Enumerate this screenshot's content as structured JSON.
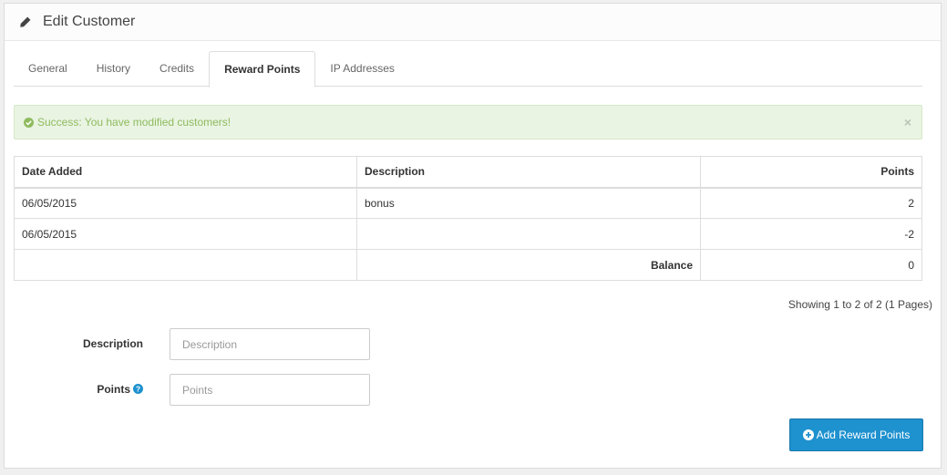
{
  "header": {
    "title": "Edit Customer",
    "icon": "pencil-icon"
  },
  "tabs": [
    {
      "label": "General",
      "active": false
    },
    {
      "label": "History",
      "active": false
    },
    {
      "label": "Credits",
      "active": false
    },
    {
      "label": "Reward Points",
      "active": true
    },
    {
      "label": "IP Addresses",
      "active": false
    }
  ],
  "alert": {
    "icon": "check-circle-icon",
    "message": "Success: You have modified customers!",
    "close_label": "×"
  },
  "table": {
    "headers": {
      "date": "Date Added",
      "description": "Description",
      "points": "Points"
    },
    "rows": [
      {
        "date": "06/05/2015",
        "description": "bonus",
        "points": "2"
      },
      {
        "date": "06/05/2015",
        "description": "",
        "points": "-2"
      }
    ],
    "balance_label": "Balance",
    "balance_value": "0"
  },
  "pagination": {
    "text": "Showing 1 to 2 of 2 (1 Pages)"
  },
  "form": {
    "description": {
      "label": "Description",
      "value": "",
      "placeholder": "Description"
    },
    "points": {
      "label": "Points",
      "value": "",
      "placeholder": "Points",
      "help_icon": "question-circle-icon"
    }
  },
  "add_button": {
    "label": "Add Reward Points",
    "icon": "plus-circle-icon"
  },
  "colors": {
    "primary": "#1e91cf",
    "success_text": "#8fbb5f",
    "success_bg": "#e9f4e3",
    "help_icon": "#1e91cf"
  }
}
